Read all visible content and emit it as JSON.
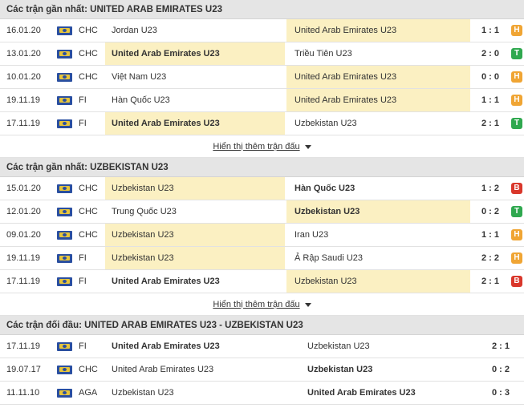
{
  "sections": [
    {
      "title": "Các trận gần nhất: UNITED ARAB EMIRATES U23",
      "matches": [
        {
          "date": "16.01.20",
          "league": "CHC",
          "home": "Jordan U23",
          "away": "United Arab Emirates U23",
          "score": "1 : 1",
          "result": "H",
          "focus": "away"
        },
        {
          "date": "13.01.20",
          "league": "CHC",
          "home": "United Arab Emirates U23",
          "away": "Triều Tiên U23",
          "score": "2 : 0",
          "result": "T",
          "focus": "home"
        },
        {
          "date": "10.01.20",
          "league": "CHC",
          "home": "Việt Nam U23",
          "away": "United Arab Emirates U23",
          "score": "0 : 0",
          "result": "H",
          "focus": "away"
        },
        {
          "date": "19.11.19",
          "league": "FI",
          "home": "Hàn Quốc U23",
          "away": "United Arab Emirates U23",
          "score": "1 : 1",
          "result": "H",
          "focus": "away"
        },
        {
          "date": "17.11.19",
          "league": "FI",
          "home": "United Arab Emirates U23",
          "away": "Uzbekistan U23",
          "score": "2 : 1",
          "result": "T",
          "focus": "home"
        }
      ],
      "more_label": "Hiển thị thêm trận đấu"
    },
    {
      "title": "Các trận gần nhất: UZBEKISTAN U23",
      "matches": [
        {
          "date": "15.01.20",
          "league": "CHC",
          "home": "Uzbekistan U23",
          "away": "Hàn Quốc U23",
          "score": "1 : 2",
          "result": "B",
          "focus": "home"
        },
        {
          "date": "12.01.20",
          "league": "CHC",
          "home": "Trung Quốc U23",
          "away": "Uzbekistan U23",
          "score": "0 : 2",
          "result": "T",
          "focus": "away"
        },
        {
          "date": "09.01.20",
          "league": "CHC",
          "home": "Uzbekistan U23",
          "away": "Iran U23",
          "score": "1 : 1",
          "result": "H",
          "focus": "home"
        },
        {
          "date": "19.11.19",
          "league": "FI",
          "home": "Uzbekistan U23",
          "away": "Ả Rập Saudi U23",
          "score": "2 : 2",
          "result": "H",
          "focus": "home"
        },
        {
          "date": "17.11.19",
          "league": "FI",
          "home": "United Arab Emirates U23",
          "away": "Uzbekistan U23",
          "score": "2 : 1",
          "result": "B",
          "focus": "away"
        }
      ],
      "more_label": "Hiển thị thêm trận đấu"
    }
  ],
  "h2h": {
    "title": "Các trận đối đầu: UNITED ARAB EMIRATES U23 - UZBEKISTAN U23",
    "matches": [
      {
        "date": "17.11.19",
        "league": "FI",
        "home": "United Arab Emirates U23",
        "away": "Uzbekistan U23",
        "score": "2 : 1",
        "winner": "home"
      },
      {
        "date": "19.07.17",
        "league": "CHC",
        "home": "United Arab Emirates U23",
        "away": "Uzbekistan U23",
        "score": "0 : 2",
        "winner": "away"
      },
      {
        "date": "11.11.10",
        "league": "AGA",
        "home": "Uzbekistan U23",
        "away": "United Arab Emirates U23",
        "score": "0 : 3",
        "winner": "away"
      }
    ]
  },
  "colors": {
    "header_bg": "#e5e5e5",
    "highlight": "#fbf0c2",
    "result_H": "#f0a534",
    "result_T": "#2fa84f",
    "result_B": "#d9372b"
  },
  "icons": {
    "league_flag": "world-flag-icon",
    "more_caret": "caret-down-icon"
  }
}
